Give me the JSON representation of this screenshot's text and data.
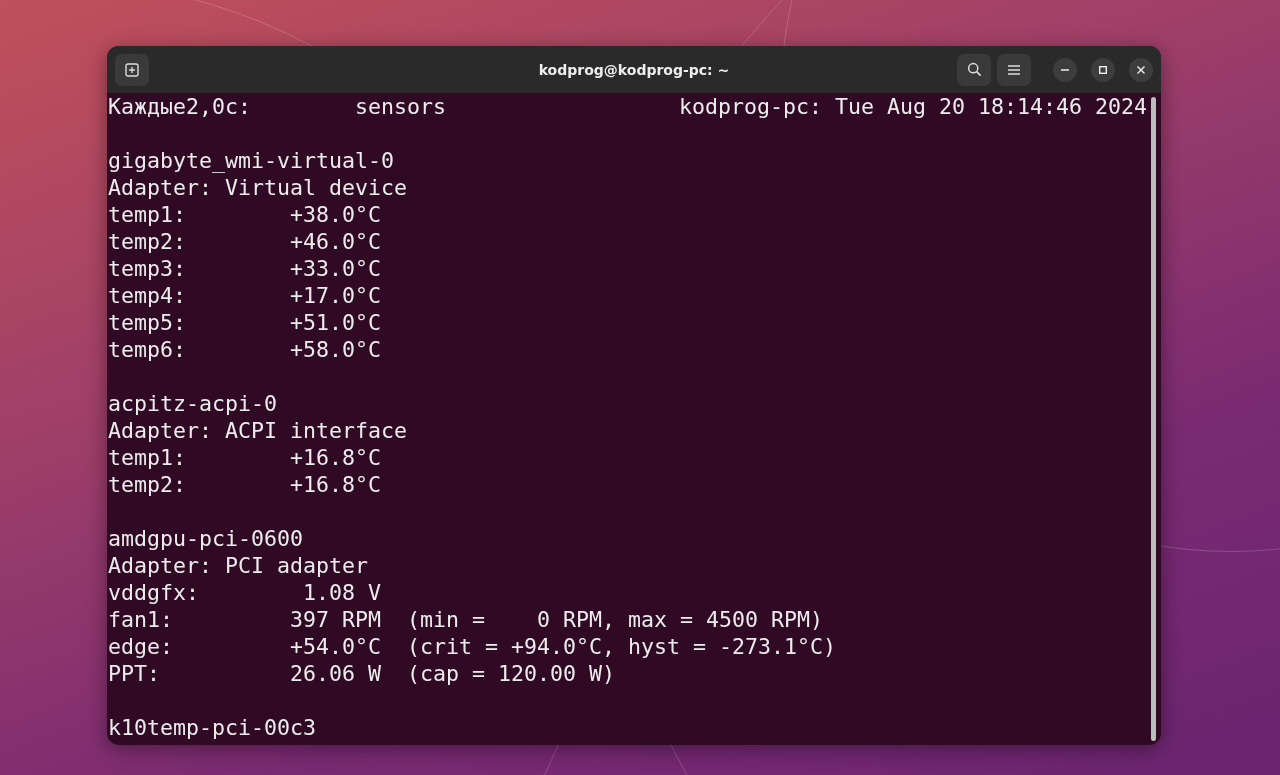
{
  "window": {
    "title": "kodprog@kodprog-pc: ~"
  },
  "watch_header": {
    "interval": "Каждые2,0с:",
    "command": "sensors",
    "host_time": "kodprog-pc: Tue Aug 20 18:14:46 2024"
  },
  "chips": [
    {
      "name": "gigabyte_wmi-virtual-0",
      "adapter": "Adapter: Virtual device",
      "readings": [
        {
          "label": "temp1:",
          "value": "+38.0°C"
        },
        {
          "label": "temp2:",
          "value": "+46.0°C"
        },
        {
          "label": "temp3:",
          "value": "+33.0°C"
        },
        {
          "label": "temp4:",
          "value": "+17.0°C"
        },
        {
          "label": "temp5:",
          "value": "+51.0°C"
        },
        {
          "label": "temp6:",
          "value": "+58.0°C"
        }
      ]
    },
    {
      "name": "acpitz-acpi-0",
      "adapter": "Adapter: ACPI interface",
      "readings": [
        {
          "label": "temp1:",
          "value": "+16.8°C"
        },
        {
          "label": "temp2:",
          "value": "+16.8°C"
        }
      ]
    },
    {
      "name": "amdgpu-pci-0600",
      "adapter": "Adapter: PCI adapter",
      "readings": [
        {
          "label": "vddgfx:",
          "value": "1.08 V"
        },
        {
          "label": "fan1:",
          "value": "397 RPM",
          "detail": "(min =    0 RPM, max = 4500 RPM)"
        },
        {
          "label": "edge:",
          "value": "+54.0°C",
          "detail": "(crit = +94.0°C, hyst = -273.1°C)"
        },
        {
          "label": "PPT:",
          "value": "26.06 W",
          "detail": "(cap = 120.00 W)"
        }
      ]
    },
    {
      "name": "k10temp-pci-00c3"
    }
  ]
}
